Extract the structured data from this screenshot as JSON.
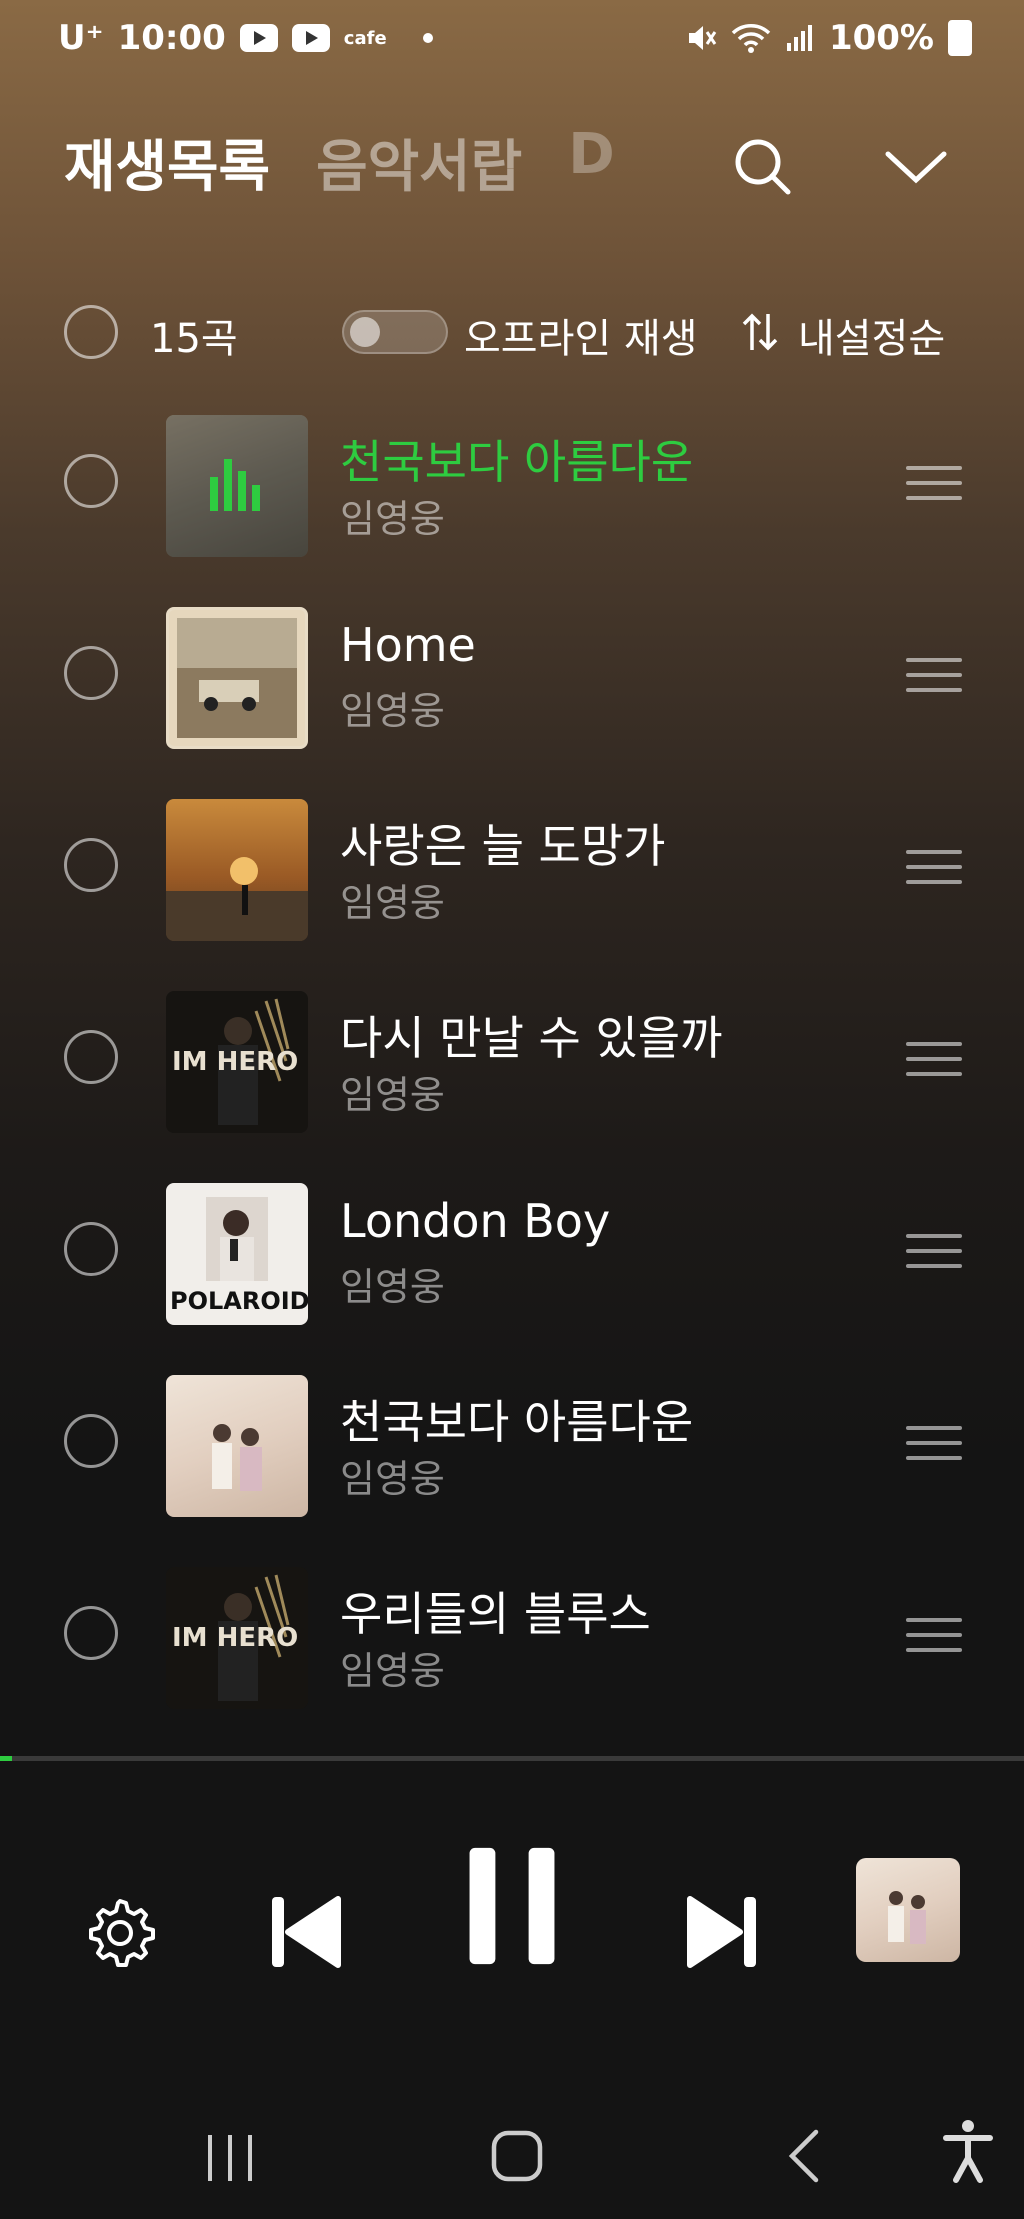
{
  "status_bar": {
    "carrier": "U⁺",
    "time": "10:00",
    "cafe_label": "cafe",
    "battery": "100%"
  },
  "header": {
    "tabs": [
      {
        "label": "재생목록",
        "active": true
      },
      {
        "label": "음악서랍",
        "active": false
      },
      {
        "label": "D",
        "active": false
      }
    ]
  },
  "toolbar": {
    "count": "15곡",
    "offline_label": "오프라인 재생",
    "sort_label": "내설정순"
  },
  "tracks": [
    {
      "title": "천국보다 아름다운",
      "artist": "임영웅",
      "playing": true
    },
    {
      "title": "Home",
      "artist": "임영웅",
      "playing": false
    },
    {
      "title": "사랑은 늘 도망가",
      "artist": "임영웅",
      "playing": false
    },
    {
      "title": "다시 만날 수 있을까",
      "artist": "임영웅",
      "playing": false
    },
    {
      "title": "London Boy",
      "artist": "임영웅",
      "playing": false,
      "cover_text": "POLAROID"
    },
    {
      "title": "천국보다 아름다운",
      "artist": "임영웅",
      "playing": false
    },
    {
      "title": "우리들의 블루스",
      "artist": "임영웅",
      "playing": false
    }
  ],
  "album_cover_text": {
    "im_hero": "IM HERO"
  },
  "player": {
    "progress": 0.012
  },
  "colors": {
    "accent": "#2ecc40",
    "background": "#141414"
  }
}
